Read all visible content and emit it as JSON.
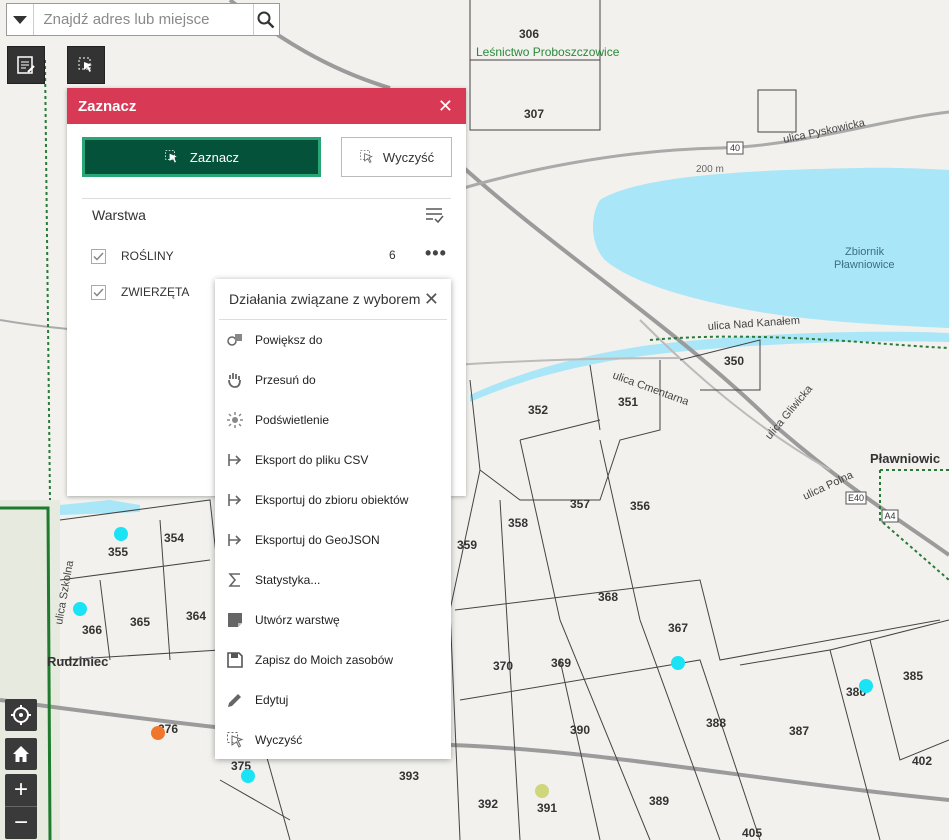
{
  "search": {
    "placeholder": "Znajdź adres lub miejsce"
  },
  "map": {
    "place_labels": [
      "Leśnictwo Proboszczowice",
      "Zbiornik",
      "Pławniowice",
      "Pławniowic",
      "Rudziniec"
    ],
    "road_labels": [
      "ulica Pyskowicka",
      "ulica Nad Kanałem",
      "ulica Cmentarna",
      "ulica Gliwicka",
      "ulica Polna",
      "ulica Szkolna",
      "200 m"
    ],
    "route_shields": [
      "40",
      "E40",
      "A4"
    ],
    "parcels": [
      "306",
      "307",
      "350",
      "351",
      "352",
      "354",
      "355",
      "356",
      "357",
      "358",
      "359",
      "364",
      "365",
      "366",
      "367",
      "368",
      "369",
      "370",
      "375",
      "376",
      "385",
      "386",
      "387",
      "388",
      "389",
      "390",
      "391",
      "392",
      "393",
      "402",
      "405"
    ]
  },
  "panel": {
    "title": "Zaznacz",
    "close": "✕",
    "select_label": "Zaznacz",
    "clear_label": "Wyczyść",
    "layer_header": "Warstwa",
    "layers": [
      {
        "name": "ROŚLINY",
        "count": "6"
      },
      {
        "name": "ZWIERZĘTA"
      }
    ]
  },
  "menu": {
    "title": "Działania związane z wyborem",
    "close": "✕",
    "items": [
      {
        "label": "Powiększ do",
        "icon": "zoom-to-icon"
      },
      {
        "label": "Przesuń do",
        "icon": "pan-hand-icon"
      },
      {
        "label": "Podświetlenie",
        "icon": "highlight-icon"
      },
      {
        "label": "Eksport do pliku CSV",
        "icon": "export-icon"
      },
      {
        "label": "Eksportuj do zbioru obiektów",
        "icon": "export-icon"
      },
      {
        "label": "Eksportuj do GeoJSON",
        "icon": "export-icon"
      },
      {
        "label": "Statystyka...",
        "icon": "sigma-icon"
      },
      {
        "label": "Utwórz warstwę",
        "icon": "layer-create-icon"
      },
      {
        "label": "Zapisz do Moich zasobów",
        "icon": "save-icon"
      },
      {
        "label": "Edytuj",
        "icon": "pencil-icon"
      },
      {
        "label": "Wyczyść",
        "icon": "clear-icon"
      }
    ]
  },
  "colors": {
    "header": "#d83a56",
    "primary": "#05523b",
    "primary_border": "#2aa576",
    "water": "#a9e6f7",
    "point_cyan": "#19e3f5",
    "point_orange": "#f0762c",
    "point_olive": "#cfd67b"
  }
}
